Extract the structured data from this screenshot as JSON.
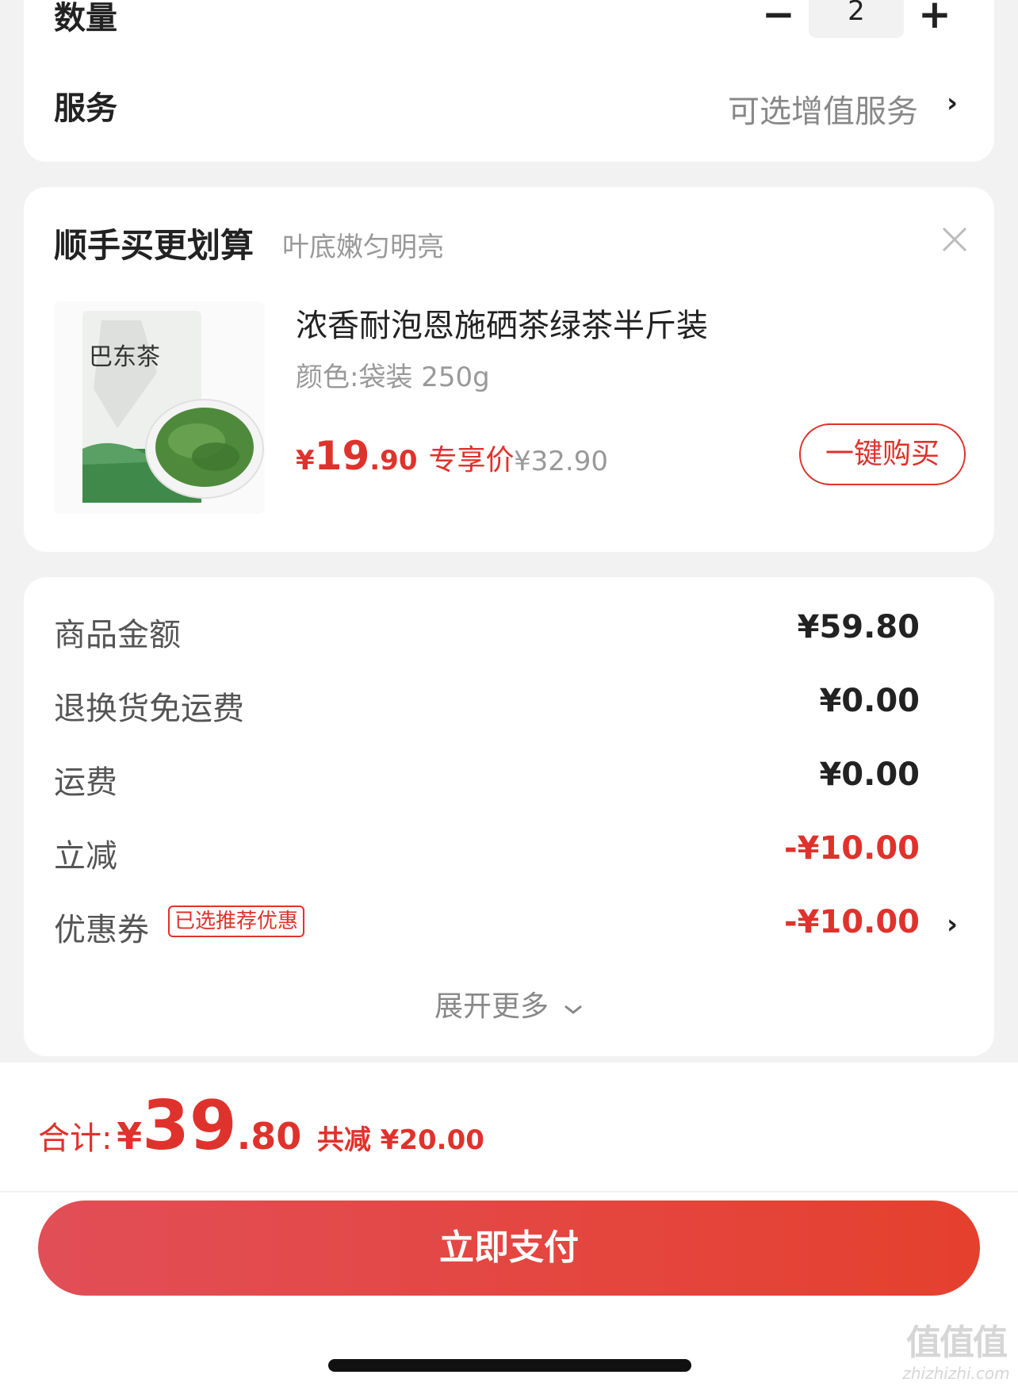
{
  "quantity": {
    "label": "数量",
    "minus": "−",
    "value": "2",
    "plus": "+"
  },
  "service": {
    "label": "服务",
    "value": "可选增值服务",
    "chevron": "›"
  },
  "upsell": {
    "title": "顺手买更划算",
    "subtitle": "叶底嫩匀明亮",
    "product": {
      "name": "浓香耐泡恩施硒茶绿茶半斤装",
      "spec": "颜色:袋装 250g",
      "price_currency": "¥",
      "price_int": "19",
      "price_dec": ".90",
      "price_tag": "专享价",
      "original_price": "¥32.90",
      "buy_label": "一键购买",
      "image_calligraphy": "巴东茶"
    }
  },
  "summary": {
    "rows": [
      {
        "label": "商品金额",
        "value": "¥59.80"
      },
      {
        "label": "退换货免运费",
        "value": "¥0.00"
      },
      {
        "label": "运费",
        "value": "¥0.00"
      },
      {
        "label": "立减",
        "value": "-¥10.00"
      },
      {
        "label": "优惠券",
        "badge": "已选推荐优惠",
        "value": "-¥10.00",
        "chevron": "›"
      }
    ],
    "expand_label": "展开更多"
  },
  "total": {
    "label": "合计:",
    "currency": "¥",
    "int": "39",
    "dec": ".80",
    "saved": "共减 ¥20.00"
  },
  "pay_button": "立即支付",
  "watermark": {
    "glyphs": "值值值",
    "text": "zhizhizhi.com"
  },
  "colors": {
    "accent": "#e0322c",
    "pay_gradient_start": "#e24e57",
    "pay_gradient_end": "#e5402e",
    "tea_green": "#3f8a4a"
  },
  "icons": {
    "close": "close-icon",
    "chevron_right": "chevron-right-icon",
    "chevron_down": "chevron-down-icon"
  }
}
